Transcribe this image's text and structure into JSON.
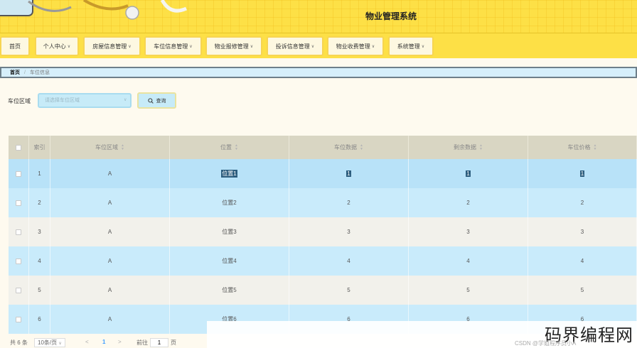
{
  "header": {
    "title": "物业管理系统"
  },
  "nav": [
    {
      "label": "首页",
      "dropdown": false
    },
    {
      "label": "个人中心",
      "dropdown": true
    },
    {
      "label": "房屋信息管理",
      "dropdown": true
    },
    {
      "label": "车位信息管理",
      "dropdown": true
    },
    {
      "label": "物业报修管理",
      "dropdown": true
    },
    {
      "label": "投诉信息管理",
      "dropdown": true
    },
    {
      "label": "物业收费管理",
      "dropdown": true
    },
    {
      "label": "系统管理",
      "dropdown": true
    }
  ],
  "breadcrumb": {
    "home": "首页",
    "separator": "/",
    "current": "车位信息"
  },
  "search": {
    "label": "车位区域",
    "placeholder": "请选择车位区域",
    "button": "查询"
  },
  "table": {
    "columns": [
      "索引",
      "车位区域",
      "位置",
      "车位数据",
      "剩余数据",
      "车位价格"
    ],
    "rows": [
      [
        "1",
        "A",
        "位置1",
        "1",
        "1",
        "1"
      ],
      [
        "2",
        "A",
        "位置2",
        "2",
        "2",
        "2"
      ],
      [
        "3",
        "A",
        "位置3",
        "3",
        "3",
        "3"
      ],
      [
        "4",
        "A",
        "位置4",
        "4",
        "4",
        "4"
      ],
      [
        "5",
        "A",
        "位置5",
        "5",
        "5",
        "5"
      ],
      [
        "6",
        "A",
        "位置6",
        "6",
        "6",
        "6"
      ]
    ],
    "row_colors": [
      "#b8e2f8",
      "#c9ebfb",
      "#f2f1eb",
      "#c9ebfb",
      "#f2f1eb",
      "#c9ebfb"
    ]
  },
  "pagination": {
    "total": "共 6 条",
    "page_size": "10条/页",
    "current_page": "1",
    "goto_label": "前往",
    "goto_value": "1",
    "page_unit": "页"
  },
  "watermark": {
    "big": "码界编程网",
    "small": "CSDN @学姐程序员小A"
  },
  "colors": {
    "header": "#fde046",
    "nav_item_bg": "#fdf8e1",
    "accent_blue": "#c7ebf8",
    "table_header": "#d9d6c3",
    "selection": "#2c5d7e"
  }
}
